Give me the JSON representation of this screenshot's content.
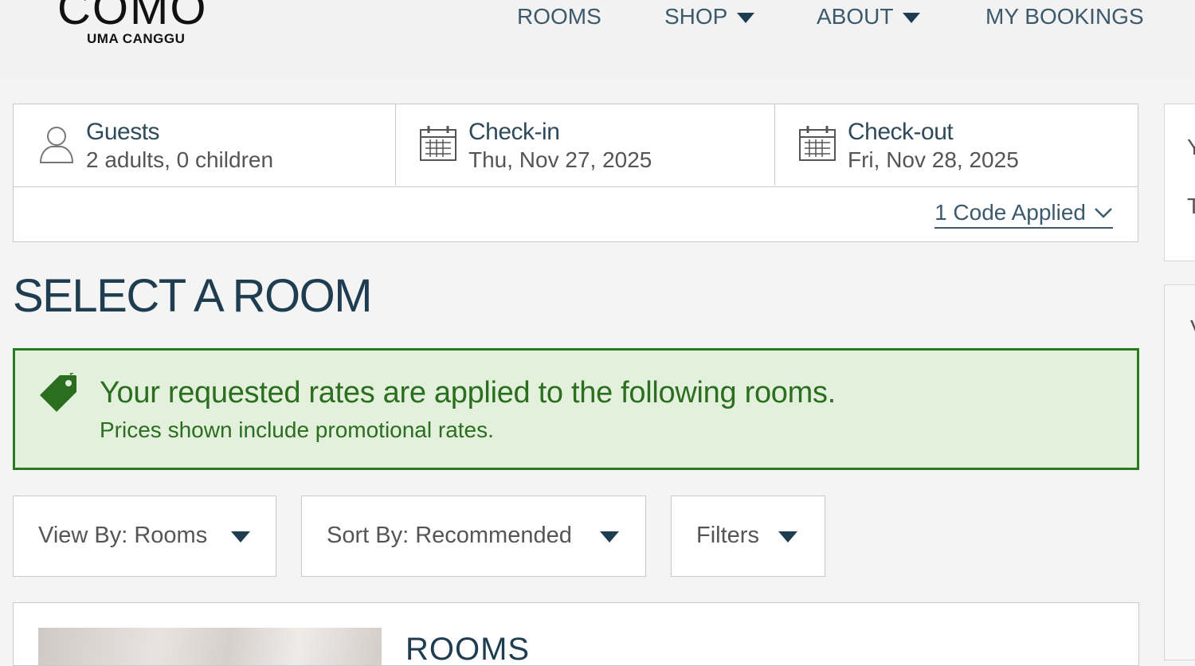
{
  "brand": {
    "name": "COMO",
    "property": "UMA CANGGU"
  },
  "nav": {
    "rooms": "ROOMS",
    "shop": "SHOP",
    "about": "ABOUT",
    "bookings": "MY BOOKINGS"
  },
  "booking": {
    "guests_label": "Guests",
    "guests_value": "2 adults, 0 children",
    "checkin_label": "Check-in",
    "checkin_value": "Thu, Nov 27, 2025",
    "checkout_label": "Check-out",
    "checkout_value": "Fri, Nov 28, 2025",
    "code_link": "1 Code Applied"
  },
  "page_title": "SELECT A ROOM",
  "alert": {
    "title": "Your requested rates are applied to the following rooms.",
    "subtitle": "Prices shown include promotional rates."
  },
  "controls": {
    "view_by": "View By: Rooms",
    "sort_by": "Sort By: Recommended",
    "filters": "Filters"
  },
  "room_section": {
    "heading": "ROOMS"
  },
  "colors": {
    "navy": "#1f3d50",
    "success_green": "#2b6e1f",
    "success_bg": "#e2f0dc"
  }
}
